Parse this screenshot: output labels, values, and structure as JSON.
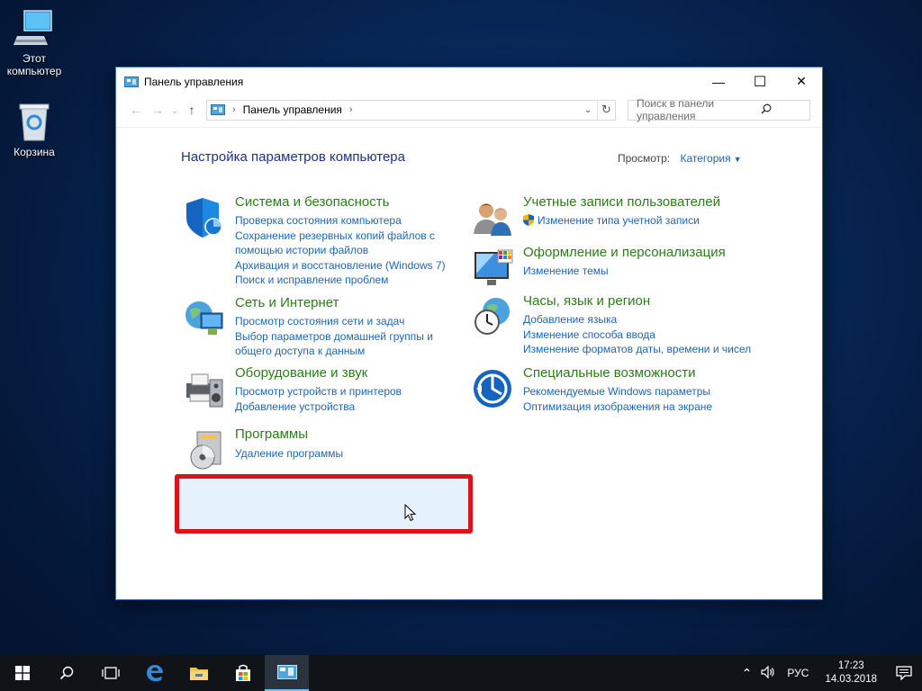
{
  "desktop": {
    "icons": [
      {
        "label": "Этот компьютер"
      },
      {
        "label": "Корзина"
      }
    ]
  },
  "window": {
    "title": "Панель управления",
    "controls": {
      "minimize": "—",
      "maximize": "☐",
      "close": "✕"
    },
    "nav": {
      "back": "←",
      "forward": "→",
      "recent": "⌄",
      "up": "↑"
    },
    "address": {
      "crumb": "Панель управления",
      "separator": "›",
      "trailing_separator": "›"
    },
    "search": {
      "placeholder": "Поиск в панели управления"
    }
  },
  "content": {
    "heading": "Настройка параметров компьютера",
    "view_by": {
      "label": "Просмотр:",
      "value": "Категория"
    },
    "left_categories": [
      {
        "title": "Система и безопасность",
        "icon": "shield-icon",
        "links": [
          "Проверка состояния компьютера",
          "Сохранение резервных копий файлов с помощью истории файлов",
          "Архивация и восстановление (Windows 7)",
          "Поиск и исправление проблем"
        ]
      },
      {
        "title": "Сеть и Интернет",
        "icon": "network-globe-icon",
        "links": [
          "Просмотр состояния сети и задач",
          "Выбор параметров домашней группы и общего доступа к данным"
        ]
      },
      {
        "title": "Оборудование и звук",
        "icon": "printer-speaker-icon",
        "links": [
          "Просмотр устройств и принтеров",
          "Добавление устройства"
        ]
      },
      {
        "title": "Программы",
        "icon": "programs-disc-icon",
        "links": [
          "Удаление программы"
        ]
      }
    ],
    "right_categories": [
      {
        "title": "Учетные записи пользователей",
        "icon": "users-icon",
        "links": [
          "Изменение типа учетной записи"
        ]
      },
      {
        "title": "Оформление и персонализация",
        "icon": "monitor-personalization-icon",
        "links": [
          "Изменение темы"
        ]
      },
      {
        "title": "Часы, язык и регион",
        "icon": "clock-globe-icon",
        "links": [
          "Добавление языка",
          "Изменение способа ввода",
          "Изменение форматов даты, времени и чисел"
        ]
      },
      {
        "title": "Специальные возможности",
        "icon": "accessibility-icon",
        "links": [
          "Рекомендуемые Windows параметры",
          "Оптимизация изображения на экране"
        ]
      }
    ]
  },
  "taskbar": {
    "tray": {
      "chevron": "⌃",
      "volume": "🔊",
      "language": "РУС"
    },
    "clock": {
      "time": "17:23",
      "date": "14.03.2018"
    }
  },
  "colors": {
    "category_title": "#2c7d19",
    "link": "#1e66b5",
    "heading": "#1e3287",
    "highlight_border": "#d9141c"
  }
}
